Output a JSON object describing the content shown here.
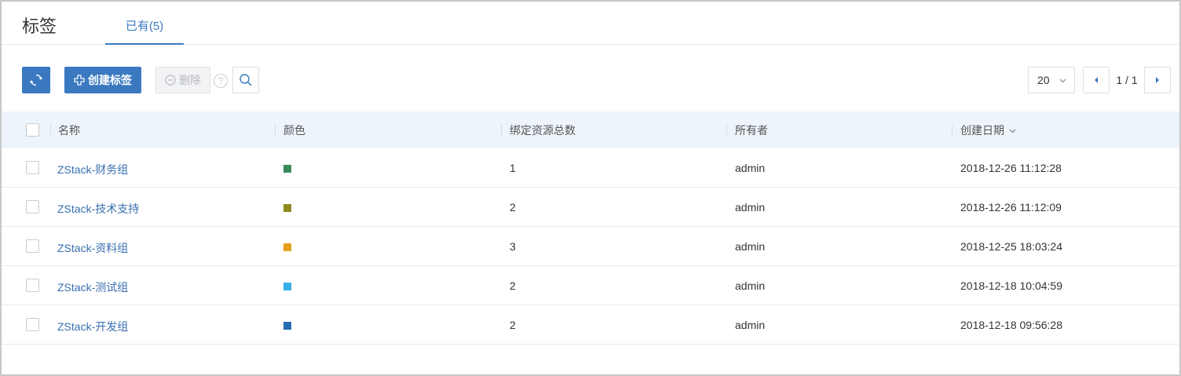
{
  "header": {
    "title": "标签",
    "tabs": [
      {
        "label": "已有(5)"
      }
    ]
  },
  "toolbar": {
    "refresh_icon": "refresh-icon",
    "create_label": "创建标签",
    "delete_label": "删除",
    "help_label": "?",
    "search_icon": "search-icon"
  },
  "pagination": {
    "page_size": "20",
    "page_text": "1 / 1"
  },
  "table": {
    "columns": [
      "名称",
      "颜色",
      "绑定资源总数",
      "所有者",
      "创建日期"
    ],
    "sort_column": "创建日期",
    "rows": [
      {
        "name": "ZStack-财务组",
        "color": "#3a8a5c",
        "count": "1",
        "owner": "admin",
        "created": "2018-12-26 11:12:28"
      },
      {
        "name": "ZStack-技术支持",
        "color": "#8c8c1e",
        "count": "2",
        "owner": "admin",
        "created": "2018-12-26 11:12:09"
      },
      {
        "name": "ZStack-资料组",
        "color": "#e5a01c",
        "count": "3",
        "owner": "admin",
        "created": "2018-12-25 18:03:24"
      },
      {
        "name": "ZStack-测试组",
        "color": "#3aaee8",
        "count": "2",
        "owner": "admin",
        "created": "2018-12-18 10:04:59"
      },
      {
        "name": "ZStack-开发组",
        "color": "#2a6cb4",
        "count": "2",
        "owner": "admin",
        "created": "2018-12-18 09:56:28"
      }
    ]
  },
  "colors": {
    "accent": "#3a79c0",
    "link": "#3a6fb0",
    "header_bg": "#eef4fb"
  }
}
